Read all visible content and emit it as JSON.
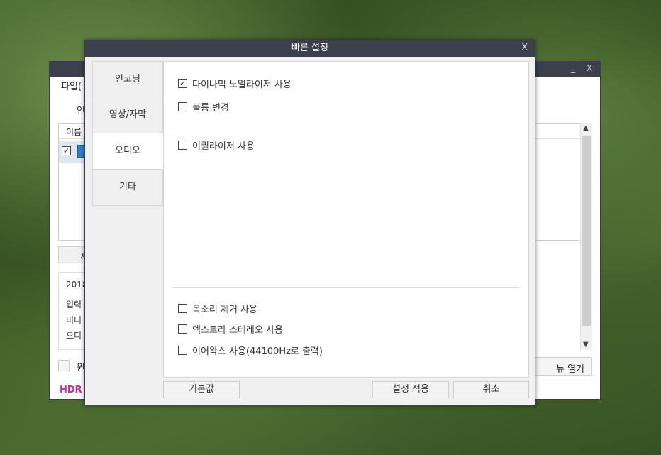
{
  "background_app": {
    "title_controls": {
      "minimize": "_",
      "close": "X"
    },
    "menu_file": "파일(",
    "tab_partial": "인",
    "list_header": "이름",
    "button_partial": "자",
    "info": {
      "date": "2018",
      "line1": "입력",
      "line2": "비디",
      "line3": "오디"
    },
    "original_label": "원",
    "menu_open_label": "뉴 열기",
    "hdr_label": "HDR"
  },
  "dialog": {
    "title": "빠른 설정",
    "close_label": "X",
    "tabs": [
      {
        "label": "인코딩"
      },
      {
        "label": "영상/자막"
      },
      {
        "label": "오디오"
      },
      {
        "label": "기타"
      }
    ],
    "options": {
      "dynamic_normalizer": {
        "label": "다이나믹 노멀라이저 사용",
        "checked": "☑"
      },
      "volume_change": {
        "label": "볼륨 변경"
      },
      "equalizer": {
        "label": "이퀄라이저 사용"
      },
      "voice_remove": {
        "label": "목소리 제거 사용"
      },
      "extra_stereo": {
        "label": "엑스트라 스테레오 사용"
      },
      "earwax": {
        "label": "이어왁스 사용(44100Hz로 출력)"
      }
    },
    "buttons": {
      "default": "기본값",
      "apply": "설정 적용",
      "cancel": "취소"
    }
  },
  "colors": {
    "titlebar": "#3c3f4c",
    "hdr": "#d6258f",
    "row_selected": "#dde8f3"
  }
}
